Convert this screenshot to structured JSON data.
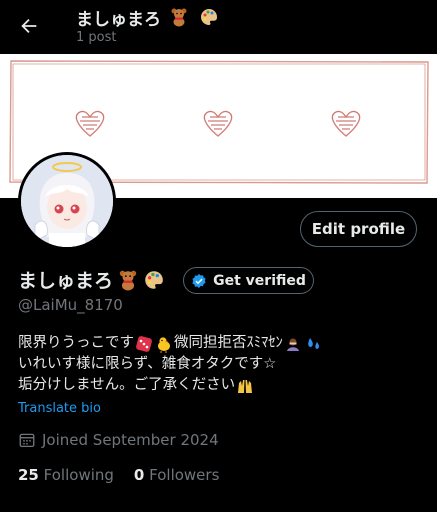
{
  "header": {
    "title": "ましゅまろ",
    "post_count": "1 post",
    "back_icon": "arrow-left-icon"
  },
  "profile": {
    "display_name": "ましゅまろ",
    "name_emojis": [
      "teddy-bear-icon",
      "artist-palette-icon"
    ],
    "handle": "@LaiMu_8170",
    "edit_profile_label": "Edit profile",
    "get_verified_label": "Get verified",
    "bio_lines": [
      {
        "text_a": "限界りうっこです",
        "text_b": "微同担拒否ｽﾐﾏｾﾝ"
      },
      {
        "text_a": "いれいす様に限らず、雑食オタクです☆",
        "text_b": ""
      },
      {
        "text_a": "垢分けしません。ご了承ください",
        "text_b": ""
      }
    ],
    "translate_label": "Translate bio",
    "joined": "Joined September 2024",
    "following_count": "25",
    "following_label": "Following",
    "followers_count": "0",
    "followers_label": "Followers"
  },
  "colors": {
    "background": "#000000",
    "accent": "#1d9bf0",
    "secondary_text": "#71767b",
    "border": "#536471",
    "verified_badge": "#1d9bf0"
  }
}
